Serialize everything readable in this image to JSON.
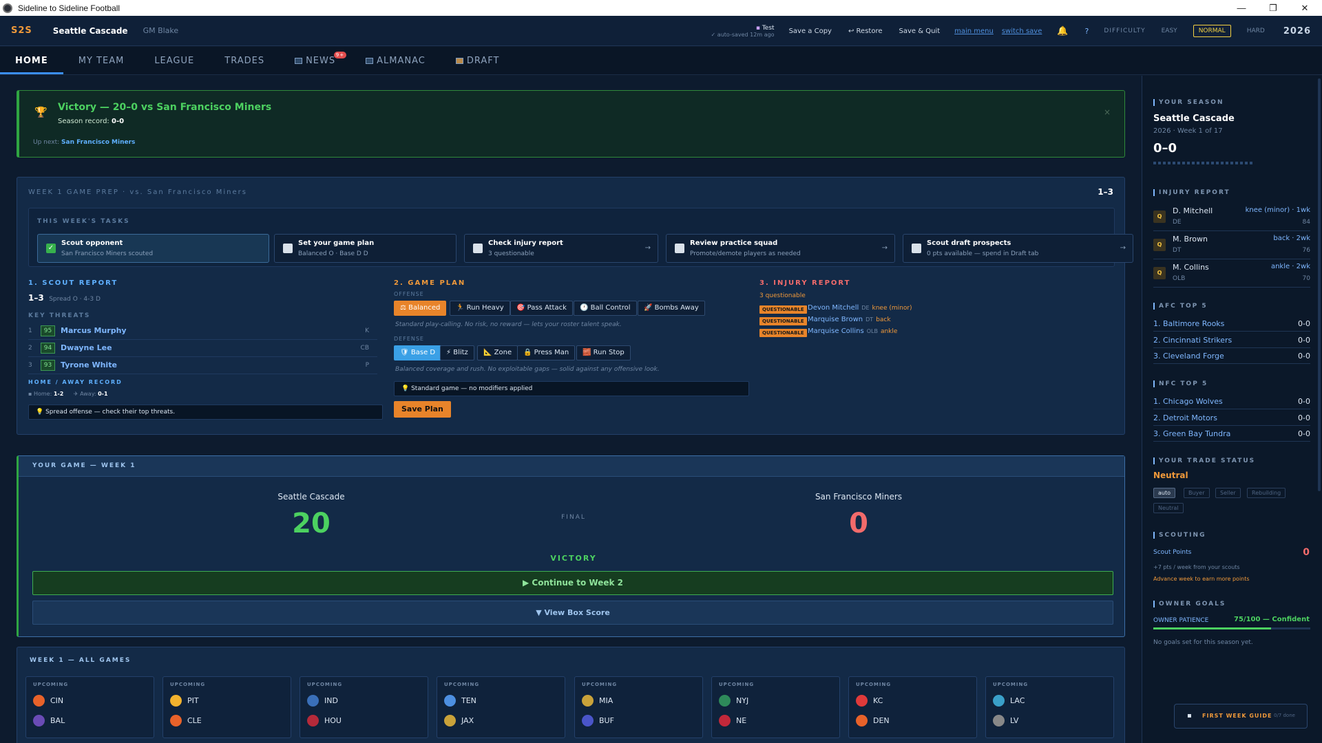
{
  "window": {
    "title": "Sideline to Sideline Football",
    "min": "—",
    "max": "❐",
    "close": "✕"
  },
  "topbar": {
    "logo": "S2S",
    "team": "Seattle Cascade",
    "gm": "GM Blake",
    "save_name": "Test",
    "save_status": "✓ auto-saved 12m ago",
    "save_copy": "Save a Copy",
    "restore": "↩ Restore",
    "save_quit": "Save & Quit",
    "main_menu": "main menu",
    "switch_save": "switch save",
    "help": "?",
    "difficulty_label": "DIFFICULTY",
    "easy": "EASY",
    "normal": "NORMAL",
    "hard": "HARD",
    "year": "2026"
  },
  "nav": {
    "home": "HOME",
    "my_team": "MY TEAM",
    "league": "LEAGUE",
    "trades": "TRADES",
    "news": "NEWS",
    "news_badge": "9+",
    "almanac": "ALMANAC",
    "draft": "DRAFT"
  },
  "victory": {
    "title": "Victory — 20–0 vs San Francisco Miners",
    "record_label": "Season record:",
    "record": "0-0",
    "next_label": "Up next:",
    "next_team": "San Francisco Miners",
    "close": "×"
  },
  "prep": {
    "title": "WEEK 1 GAME PREP · vs. San Francisco Miners",
    "record": "1–3",
    "tasks_label": "THIS WEEK'S TASKS",
    "tasks": [
      {
        "title": "Scout opponent",
        "sub": "San Francisco Miners scouted",
        "arrow": ""
      },
      {
        "title": "Set your game plan",
        "sub": "Balanced O · Base D D",
        "arrow": ""
      },
      {
        "title": "Check injury report",
        "sub": "3 questionable",
        "arrow": "→"
      },
      {
        "title": "Review practice squad",
        "sub": "Promote/demote players as needed",
        "arrow": "→"
      },
      {
        "title": "Scout draft prospects",
        "sub": "0 pts available — spend in Draft tab",
        "arrow": "→"
      }
    ],
    "scout": {
      "title": "1. SCOUT REPORT",
      "record": "1–3",
      "scheme": "Spread O · 4-3 D",
      "threats_label": "KEY THREATS",
      "threats": [
        {
          "n": "1",
          "rating": "95",
          "name": "Marcus Murphy",
          "pos": "K"
        },
        {
          "n": "2",
          "rating": "94",
          "name": "Dwayne Lee",
          "pos": "CB"
        },
        {
          "n": "3",
          "rating": "93",
          "name": "Tyrone White",
          "pos": "P"
        }
      ],
      "ha_label": "HOME / AWAY RECORD",
      "home_label": "Home:",
      "home": "1-2",
      "away_label": "Away:",
      "away": "0-1",
      "tip": "Spread offense — check their top threats."
    },
    "plan": {
      "title": "2. GAME PLAN",
      "offense_label": "OFFENSE",
      "offense": [
        "Balanced",
        "Run Heavy",
        "Pass Attack",
        "Ball Control",
        "Bombs Away"
      ],
      "offense_note": "Standard play-calling. No risk, no reward — lets your roster talent speak.",
      "defense_label": "DEFENSE",
      "defense": [
        "Base D",
        "Blitz",
        "Zone",
        "Press Man",
        "Run Stop"
      ],
      "defense_note": "Balanced coverage and rush. No exploitable gaps — solid against any offensive look.",
      "hint": "Standard game — no modifiers applied",
      "save": "Save Plan"
    },
    "injury": {
      "title": "3. INJURY REPORT",
      "count": "3 questionable",
      "tag": "QUESTIONABLE",
      "players": [
        {
          "name": "Devon Mitchell",
          "pos": "DE",
          "type": "knee (minor)"
        },
        {
          "name": "Marquise Brown",
          "pos": "DT",
          "type": "back"
        },
        {
          "name": "Marquise Collins",
          "pos": "OLB",
          "type": "ankle"
        }
      ]
    }
  },
  "game": {
    "title": "YOUR GAME — WEEK 1",
    "home": "Seattle Cascade",
    "home_score": "20",
    "away": "San Francisco Miners",
    "away_score": "0",
    "status": "FINAL",
    "result": "VICTORY",
    "continue": "▶ Continue to Week 2",
    "box": "▼ View Box Score"
  },
  "all_games": {
    "title": "WEEK 1 — ALL GAMES",
    "upcoming": "UPCOMING",
    "games": [
      {
        "a": "CIN",
        "b": "BAL",
        "ca": "#e8622a",
        "cb": "#6a4bb5"
      },
      {
        "a": "PIT",
        "b": "CLE",
        "ca": "#f2b22e",
        "cb": "#e8622a"
      },
      {
        "a": "IND",
        "b": "HOU",
        "ca": "#3a6fb8",
        "cb": "#b52a3a"
      },
      {
        "a": "TEN",
        "b": "JAX",
        "ca": "#4d8fe0",
        "cb": "#c9a23a"
      },
      {
        "a": "MIA",
        "b": "BUF",
        "ca": "#c9a23a",
        "cb": "#4a55c9"
      },
      {
        "a": "NYJ",
        "b": "NE",
        "ca": "#2e8a5a",
        "cb": "#c2283a"
      },
      {
        "a": "KC",
        "b": "DEN",
        "ca": "#e03a3a",
        "cb": "#e8622a"
      },
      {
        "a": "LAC",
        "b": "LV",
        "ca": "#3aa0c9",
        "cb": "#888888"
      }
    ]
  },
  "sidebar": {
    "season_label": "YOUR SEASON",
    "team": "Seattle Cascade",
    "sub": "2026 · Week 1 of 17",
    "record": "0–0",
    "injury_label": "INJURY REPORT",
    "q": "Q",
    "injuries": [
      {
        "name": "D. Mitchell",
        "pos": "DE",
        "type": "knee (minor) · 1wk",
        "ovr": "84"
      },
      {
        "name": "M. Brown",
        "pos": "DT",
        "type": "back · 2wk",
        "ovr": "76"
      },
      {
        "name": "M. Collins",
        "pos": "OLB",
        "type": "ankle · 2wk",
        "ovr": "70"
      }
    ],
    "afc_label": "AFC TOP 5",
    "afc": [
      {
        "t": "1. Baltimore Rooks",
        "r": "0-0"
      },
      {
        "t": "2. Cincinnati Strikers",
        "r": "0-0"
      },
      {
        "t": "3. Cleveland Forge",
        "r": "0-0"
      }
    ],
    "nfc_label": "NFC TOP 5",
    "nfc": [
      {
        "t": "1. Chicago Wolves",
        "r": "0-0"
      },
      {
        "t": "2. Detroit Motors",
        "r": "0-0"
      },
      {
        "t": "3. Green Bay Tundra",
        "r": "0-0"
      }
    ],
    "trade_label": "YOUR TRADE STATUS",
    "trade_status": "Neutral",
    "trade_tags": [
      "auto",
      "Buyer",
      "Seller",
      "Rebuilding",
      "Neutral"
    ],
    "scout_label": "SCOUTING",
    "scout_points_label": "Scout Points",
    "scout_points": "0",
    "scout_rate": "+7 pts / week from your scouts",
    "scout_tip": "Advance week to earn more points",
    "owner_label": "OWNER GOALS",
    "patience_label": "OWNER PATIENCE",
    "patience": "75/100 — Confident",
    "patience_value": 0.75,
    "goals": "No goals set for this season yet.",
    "guide": "FIRST WEEK GUIDE",
    "guide_progress": "0/7 done"
  },
  "colors": {
    "accent": "#e8842a",
    "win": "#4cd160",
    "loss": "#f26b6b",
    "link": "#7fb7ff"
  }
}
